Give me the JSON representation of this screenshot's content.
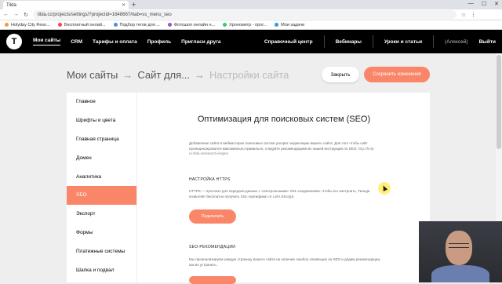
{
  "browser": {
    "tab_title": "Tilda",
    "url": "tilda.cc/projects/settings/?projectid=1648667#tab=ss_menu_seo",
    "bookmarks": [
      "Holyday City Reso...",
      "Бесплатный онлай...",
      "Подбор тегов для ...",
      "Фотошоп онлайн н...",
      "Хронометр - прог...",
      "Мои задачи"
    ]
  },
  "topnav": {
    "logo": "T",
    "items": [
      "Мои сайты",
      "CRM",
      "Тарифы и оплата",
      "Профиль",
      "Пригласи друга"
    ],
    "right_items": [
      "Справочный центр",
      "Вебинары",
      "Уроки и статьи"
    ],
    "user": "(Алексей)",
    "logout": "Выйти"
  },
  "breadcrumb": {
    "c1": "Мои сайты",
    "c2": "Сайт для...",
    "c3": "Настройки сайта",
    "arrow": "→"
  },
  "actions": {
    "close": "Закрыть",
    "save": "Сохранить изменения"
  },
  "sidebar": {
    "items": [
      "Главное",
      "Шрифты и цвета",
      "Главная страница",
      "Домен",
      "Аналитика",
      "SEO",
      "Экспорт",
      "Формы",
      "Платежные системы",
      "Шапка и подвал"
    ]
  },
  "content": {
    "title": "Оптимизация для поисковых систем (SEO)",
    "intro": "Добавление сайта в вебмастерах поисковых систем ускорит индексацию вашего сайта. Для того чтобы сайт проиндексировался максимально правильно, следуйте рекомендациям из нашей инструкции по SEO:",
    "intro_link": "http://help-ru.tilda.ws/search-engine",
    "https_heading": "НАСТРОЙКА HTTPS",
    "https_text": "HTTPS — протокол для передачи данных с «контрольными» SSL-соединением. Чтобы его настроить, Тильда позволяет бесплатно получить SSL-сертификат от Let's Encrypt.",
    "https_button": "Подключить",
    "rec_heading": "SEO-РЕКОМЕНДАЦИИ",
    "rec_text": "Мы проанализируем каждую страницу вашего сайта на наличие ошибок, влияющих на SEO и дадим рекомендации, как их устранить."
  },
  "colors": {
    "accent": "#fa8669",
    "nav_bg": "#000000",
    "page_bg": "#eeeeee"
  }
}
